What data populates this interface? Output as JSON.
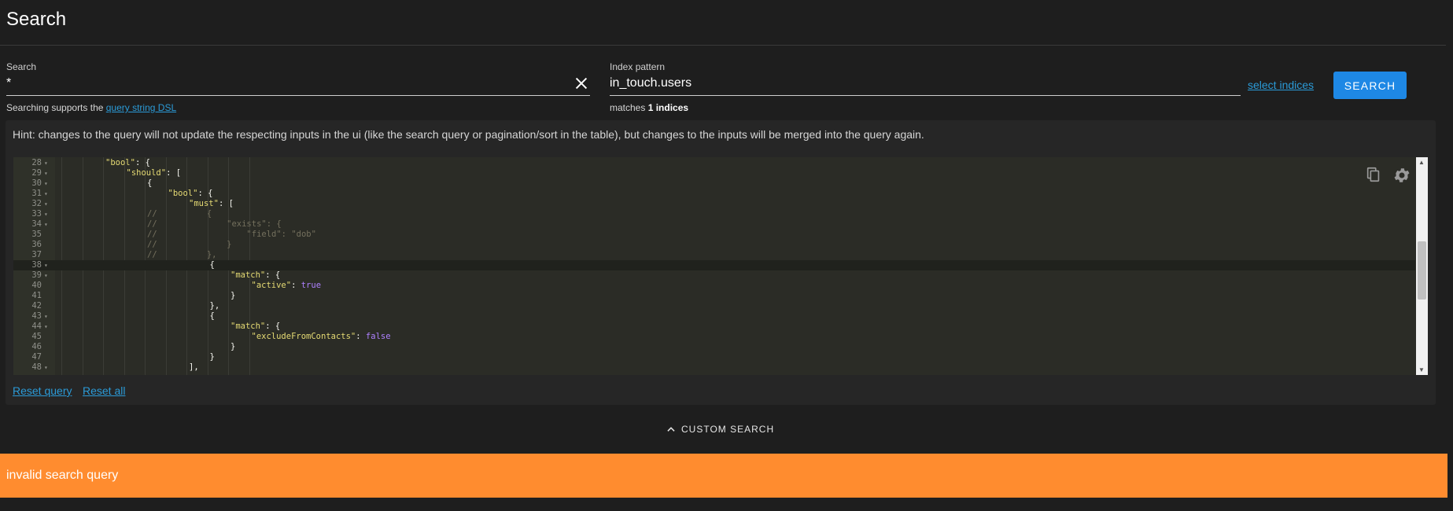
{
  "header": {
    "title": "Search"
  },
  "search": {
    "label": "Search",
    "value": "*",
    "helper_prefix": "Searching supports the ",
    "helper_link": "query string DSL"
  },
  "index": {
    "label": "Index pattern",
    "value": "in_touch.users",
    "helper_prefix": "matches ",
    "helper_bold": "1 indices",
    "select_label": "select indices"
  },
  "search_button": "SEARCH",
  "hint": "Hint: changes to the query will not update the respecting inputs in the ui (like the search query or pagination/sort in the table), but changes to the inputs will be merged into the query again.",
  "editor": {
    "active_line": 38,
    "lines": [
      {
        "n": "28",
        "fold": true,
        "indent": 2,
        "tokens": [
          [
            "str",
            "\"bool\""
          ],
          [
            "p",
            ": {"
          ]
        ]
      },
      {
        "n": "29",
        "fold": true,
        "indent": 3,
        "tokens": [
          [
            "str",
            "\"should\""
          ],
          [
            "p",
            ": ["
          ]
        ]
      },
      {
        "n": "30",
        "fold": true,
        "indent": 4,
        "tokens": [
          [
            "p",
            "{"
          ]
        ]
      },
      {
        "n": "31",
        "fold": true,
        "indent": 5,
        "tokens": [
          [
            "str",
            "\"bool\""
          ],
          [
            "p",
            ": {"
          ]
        ]
      },
      {
        "n": "32",
        "fold": true,
        "indent": 6,
        "tokens": [
          [
            "str",
            "\"must\""
          ],
          [
            "p",
            ": ["
          ]
        ]
      },
      {
        "n": "33",
        "fold": true,
        "indent": 4,
        "tokens": [
          [
            "cmt",
            "//          {"
          ]
        ]
      },
      {
        "n": "34",
        "fold": true,
        "indent": 4,
        "tokens": [
          [
            "cmt",
            "//              \"exists\": {"
          ]
        ]
      },
      {
        "n": "35",
        "fold": false,
        "indent": 4,
        "tokens": [
          [
            "cmt",
            "//                  \"field\": \"dob\""
          ]
        ]
      },
      {
        "n": "36",
        "fold": false,
        "indent": 4,
        "tokens": [
          [
            "cmt",
            "//              }"
          ]
        ]
      },
      {
        "n": "37",
        "fold": false,
        "indent": 4,
        "tokens": [
          [
            "cmt",
            "//          },"
          ]
        ]
      },
      {
        "n": "38",
        "fold": true,
        "indent": 7,
        "tokens": [
          [
            "p",
            "{"
          ]
        ]
      },
      {
        "n": "39",
        "fold": true,
        "indent": 8,
        "tokens": [
          [
            "str",
            "\"match\""
          ],
          [
            "p",
            ": {"
          ]
        ]
      },
      {
        "n": "40",
        "fold": false,
        "indent": 9,
        "tokens": [
          [
            "str",
            "\"active\""
          ],
          [
            "p",
            ": "
          ],
          [
            "num",
            "true"
          ]
        ]
      },
      {
        "n": "41",
        "fold": false,
        "indent": 8,
        "tokens": [
          [
            "p",
            "}"
          ]
        ]
      },
      {
        "n": "42",
        "fold": false,
        "indent": 7,
        "tokens": [
          [
            "p",
            "},"
          ]
        ]
      },
      {
        "n": "43",
        "fold": true,
        "indent": 7,
        "tokens": [
          [
            "p",
            "{"
          ]
        ]
      },
      {
        "n": "44",
        "fold": true,
        "indent": 8,
        "tokens": [
          [
            "str",
            "\"match\""
          ],
          [
            "p",
            ": {"
          ]
        ]
      },
      {
        "n": "45",
        "fold": false,
        "indent": 9,
        "tokens": [
          [
            "str",
            "\"excludeFromContacts\""
          ],
          [
            "p",
            ": "
          ],
          [
            "num",
            "false"
          ]
        ]
      },
      {
        "n": "46",
        "fold": false,
        "indent": 8,
        "tokens": [
          [
            "p",
            "}"
          ]
        ]
      },
      {
        "n": "47",
        "fold": false,
        "indent": 7,
        "tokens": [
          [
            "p",
            "}"
          ]
        ]
      },
      {
        "n": "48",
        "fold": true,
        "indent": 6,
        "tokens": [
          [
            "p",
            "],"
          ]
        ]
      }
    ]
  },
  "reset_query": "Reset query",
  "reset_all": "Reset all",
  "custom_search": "CUSTOM SEARCH",
  "error": "invalid search query",
  "colors": {
    "accent": "#1e88e5",
    "link": "#2b9bd8",
    "warning": "#ff8c2f"
  }
}
